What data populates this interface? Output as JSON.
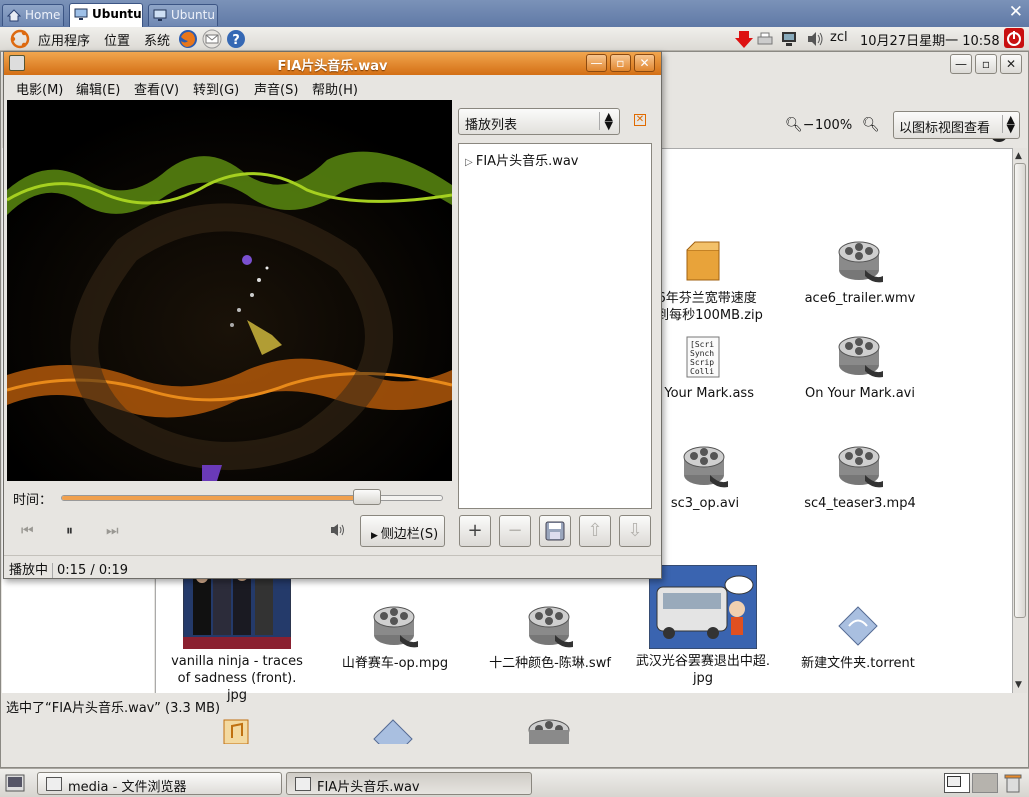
{
  "tabs": [
    {
      "label": "Home"
    },
    {
      "label": "Ubuntu"
    },
    {
      "label": "Ubuntu"
    }
  ],
  "panel": {
    "menus": [
      "应用程序",
      "位置",
      "系统"
    ],
    "user": "zcl",
    "datetime": "10月27日星期一 10:58"
  },
  "player": {
    "title": "FIA片头音乐.wav",
    "menus": [
      "电影(M)",
      "编辑(E)",
      "查看(V)",
      "转到(G)",
      "声音(S)",
      "帮助(H)"
    ],
    "time_label": "时间：",
    "progress": 0.8,
    "sidebar_label": "侧边栏(S)",
    "status": "播放中",
    "position": "0:15 / 0:19",
    "playlist_select": "播放列表",
    "playlist_items": [
      "FIA片头音乐.wav"
    ]
  },
  "browser": {
    "zoom": "100%",
    "view_mode": "以图标视图查看",
    "files": [
      {
        "label": "16年芬兰宽带速度\n达到每秒100MB.zip",
        "kind": "zip"
      },
      {
        "label": "ace6_trailer.wmv",
        "kind": "video"
      },
      {
        "label": "n Your Mark.ass",
        "kind": "text"
      },
      {
        "label": "On Your Mark.avi",
        "kind": "video"
      },
      {
        "label": "sc3_op.avi",
        "kind": "video"
      },
      {
        "label": "sc4_teaser3.mp4",
        "kind": "video"
      },
      {
        "label": "vanilla ninja - traces\nof sadness (front).\njpg",
        "kind": "photo"
      },
      {
        "label": "山脊赛车-op.mpg",
        "kind": "video"
      },
      {
        "label": "十二种颜色-陈琳.swf",
        "kind": "video"
      },
      {
        "label": "武汉光谷罢赛退出中超.\njpg",
        "kind": "photo"
      },
      {
        "label": "新建文件夹.torrent",
        "kind": "torrent"
      }
    ],
    "status": "选中了“FIA片头音乐.wav” (3.3 MB)"
  },
  "taskbar": [
    {
      "label": "media - 文件浏览器"
    },
    {
      "label": "FIA片头音乐.wav"
    }
  ]
}
